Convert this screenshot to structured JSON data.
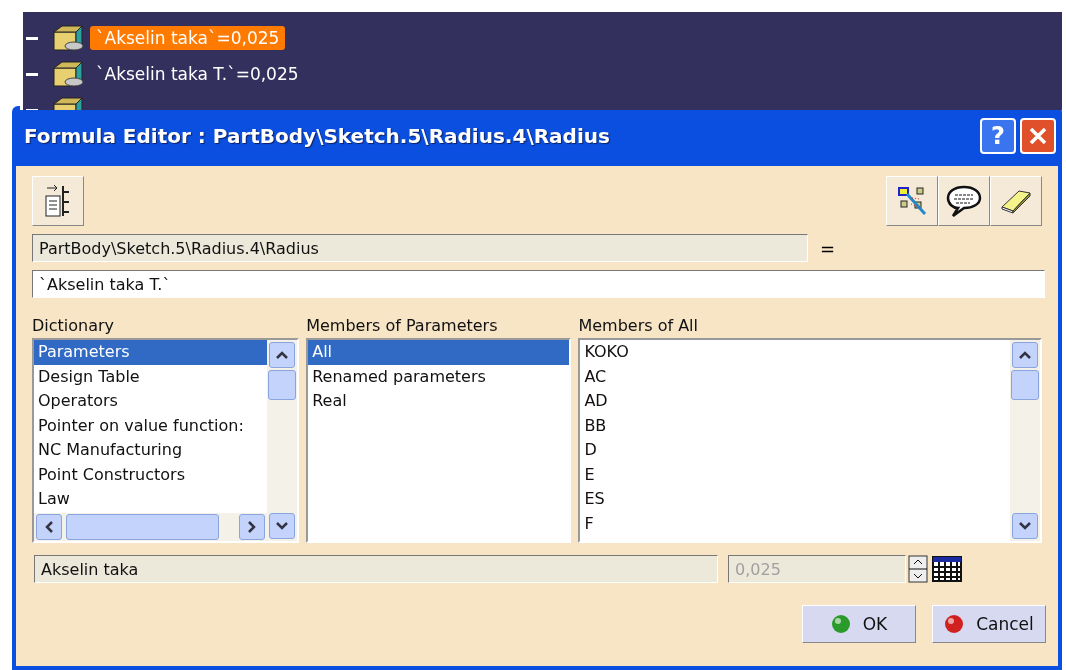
{
  "tree": {
    "items": [
      {
        "label": "`Akselin taka`=0,025",
        "selected": true
      },
      {
        "label": "`Akselin taka T.`=0,025",
        "selected": false
      }
    ]
  },
  "window": {
    "title": "Formula Editor : PartBody\\Sketch.5\\Radius.4\\Radius",
    "help": "?"
  },
  "parameter_path": {
    "value": "PartBody\\Sketch.5\\Radius.4\\Radius"
  },
  "equals": "=",
  "formula": {
    "value": "`Akselin taka T.`"
  },
  "dictionary": {
    "label": "Dictionary",
    "items": [
      {
        "label": "Parameters",
        "selected": true
      },
      {
        "label": "Design Table",
        "selected": false
      },
      {
        "label": "Operators",
        "selected": false
      },
      {
        "label": "Pointer on value function:",
        "selected": false
      },
      {
        "label": "NC Manufacturing",
        "selected": false
      },
      {
        "label": "Point Constructors",
        "selected": false
      },
      {
        "label": "Law",
        "selected": false
      }
    ]
  },
  "members_of_parameters": {
    "label": "Members of Parameters",
    "items": [
      {
        "label": "All",
        "selected": true
      },
      {
        "label": "Renamed parameters",
        "selected": false
      },
      {
        "label": "Real",
        "selected": false
      }
    ]
  },
  "members_of_all": {
    "label": "Members of All",
    "items": [
      {
        "label": "KOKO",
        "selected": false
      },
      {
        "label": "AC",
        "selected": false
      },
      {
        "label": "AD",
        "selected": false
      },
      {
        "label": "BB",
        "selected": false
      },
      {
        "label": "D",
        "selected": false
      },
      {
        "label": "E",
        "selected": false
      },
      {
        "label": "ES",
        "selected": false
      },
      {
        "label": "F",
        "selected": false
      }
    ]
  },
  "selected_parameter": {
    "value": "Akselin taka"
  },
  "parameter_value": {
    "value": "0,025",
    "disabled": true
  },
  "buttons": [
    {
      "label": "OK",
      "kind": "ok"
    },
    {
      "label": "Cancel",
      "kind": "cancel"
    }
  ]
}
